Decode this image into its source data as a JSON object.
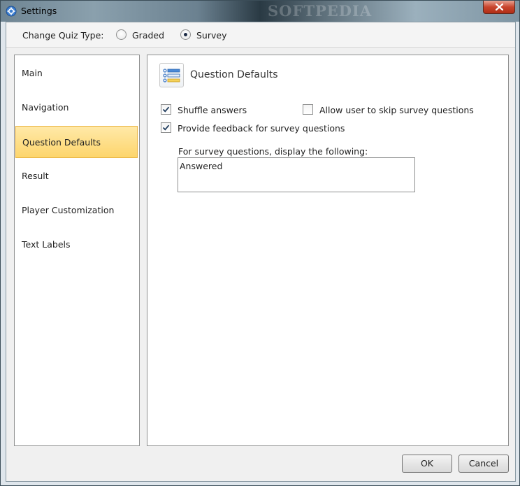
{
  "window": {
    "title": "Settings",
    "watermark": "SOFTPEDIA"
  },
  "quiz_type": {
    "label": "Change Quiz Type:",
    "options": [
      {
        "label": "Graded",
        "selected": false
      },
      {
        "label": "Survey",
        "selected": true
      }
    ]
  },
  "sidebar": {
    "items": [
      {
        "label": "Main",
        "active": false
      },
      {
        "label": "Navigation",
        "active": false
      },
      {
        "label": "Question Defaults",
        "active": true
      },
      {
        "label": "Result",
        "active": false
      },
      {
        "label": "Player Customization",
        "active": false
      },
      {
        "label": "Text Labels",
        "active": false
      }
    ]
  },
  "panel": {
    "title": "Question Defaults",
    "icon": "list-settings-icon",
    "options": {
      "shuffle": {
        "label": "Shuffle answers",
        "checked": true
      },
      "skip": {
        "label": "Allow user to skip survey questions",
        "checked": false
      },
      "feedback": {
        "label": "Provide feedback for survey questions",
        "checked": true
      }
    },
    "survey_display": {
      "label": "For survey questions, display the following:",
      "value": "Answered"
    }
  },
  "buttons": {
    "ok": "OK",
    "cancel": "Cancel"
  },
  "colors": {
    "active_item": "#fdd56c",
    "accent_border": "#e9b443"
  }
}
